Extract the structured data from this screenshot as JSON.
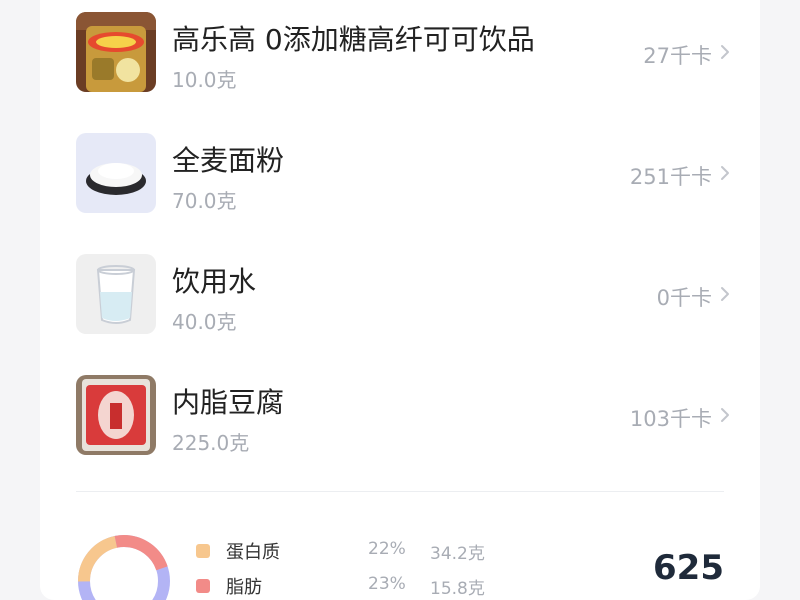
{
  "foods": [
    {
      "name": "高乐高 0添加糖高纤可可饮品",
      "weight": "10.0克",
      "kcal": "27千卡"
    },
    {
      "name": "全麦面粉",
      "weight": "70.0克",
      "kcal": "251千卡"
    },
    {
      "name": "饮用水",
      "weight": "40.0克",
      "kcal": "0千卡"
    },
    {
      "name": "内脂豆腐",
      "weight": "225.0克",
      "kcal": "103千卡"
    }
  ],
  "summary": {
    "macros": [
      {
        "label": "蛋白质",
        "percent": "22%",
        "amount": "34.2克",
        "color": "#f7c78e"
      },
      {
        "label": "脂肪",
        "percent": "23%",
        "amount": "15.8克",
        "color": "#f28b88"
      }
    ],
    "total_kcal": "625"
  },
  "colors": {
    "muted_text": "#a8acb4",
    "carb_segment": "#b3b4f5",
    "protein_segment": "#f7c78e",
    "fat_segment": "#f28b88"
  },
  "icons": {
    "row_chevron": "chevron-right-icon"
  }
}
